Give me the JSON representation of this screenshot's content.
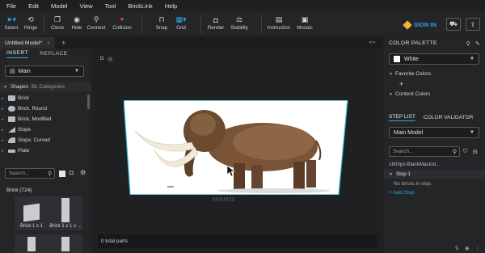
{
  "menu": [
    "File",
    "Edit",
    "Model",
    "View",
    "Tool",
    "BrickLink",
    "Help"
  ],
  "toolbar": {
    "tools": [
      {
        "label": "Select",
        "icon": "arrow-icon"
      },
      {
        "label": "Hinge",
        "icon": "hinge-icon"
      },
      {
        "label": "Clone",
        "icon": "clone-icon"
      },
      {
        "label": "Hide",
        "icon": "eye-icon"
      },
      {
        "label": "Connect",
        "icon": "connect-icon"
      },
      {
        "label": "Collision",
        "icon": "collision-icon"
      },
      {
        "label": "Snap",
        "icon": "snap-icon"
      },
      {
        "label": "Grid",
        "icon": "grid-icon"
      },
      {
        "label": "Render",
        "icon": "camera-icon"
      },
      {
        "label": "Stability",
        "icon": "stability-icon"
      },
      {
        "label": "Instruction",
        "icon": "instruction-icon"
      },
      {
        "label": "Mosaic",
        "icon": "mosaic-icon"
      }
    ],
    "sign_in": "SIGN IN"
  },
  "tabs": {
    "doc_title": "Untitled Model*",
    "close": "×",
    "add": "+"
  },
  "left_panel": {
    "tab_insert": "INSERT",
    "tab_replace": "REPLACE",
    "palette_select": "Main",
    "shapes_label": "Shapes",
    "categories_label": "BL Categories",
    "categories": [
      "Brick",
      "Brick, Round",
      "Brick, Modified",
      "Slope",
      "Slope, Curved",
      "Plate"
    ],
    "search_placeholder": "Search...",
    "brick_header": "Brick (724)",
    "bricks": [
      "Brick 1 x 1",
      "Brick 1 x 1 x ..."
    ]
  },
  "viewport": {
    "status": "0 total parts"
  },
  "right_panel": {
    "color_palette": "COLOR PALETTE",
    "selected_color": "White",
    "favorite_colors": "Favorite Colors",
    "content_colors": "Content Colors",
    "step_list": "STEP LIST",
    "color_validator": "COLOR VALIDATOR",
    "model_select": "Main Model",
    "search_placeholder": "Search...",
    "file_name": "1600px-BlankMastod...",
    "step_label": "Step 1",
    "no_bricks": "No bricks in step.",
    "add_step": "+ Add Step"
  },
  "colors": {
    "accent": "#2aa8e6",
    "collision": "#e24545",
    "logo": "#f2b632"
  }
}
